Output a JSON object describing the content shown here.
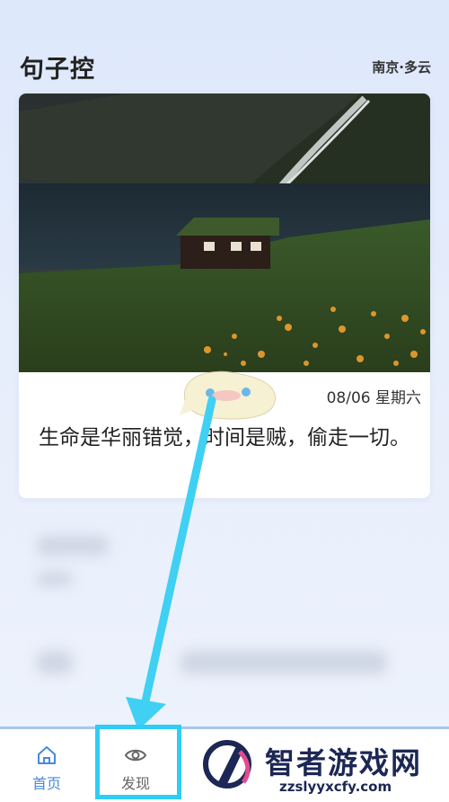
{
  "header": {
    "app_title": "句子控",
    "location": "南京·多云"
  },
  "card": {
    "date": "08/06 星期六",
    "quote": "生命是华丽错觉，时间是贼，偷走一切。"
  },
  "tabbar": {
    "items": [
      {
        "label": "首页",
        "icon": "home-icon"
      },
      {
        "label": "发现",
        "icon": "eye-icon"
      }
    ]
  },
  "watermark": {
    "text": "智者游戏网",
    "url": "zzslyyxcfy.com"
  },
  "colors": {
    "accent": "#4a88db",
    "highlight": "#2ecdf3",
    "arrow": "#3fd0f4"
  }
}
